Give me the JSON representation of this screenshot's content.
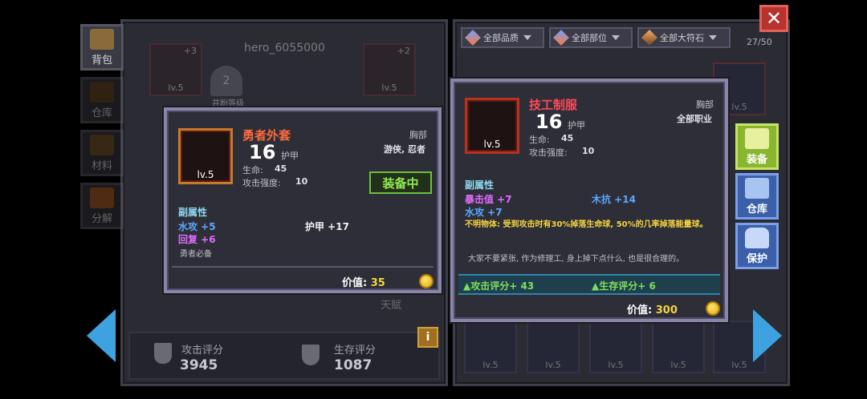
{
  "colors": {
    "accent_blue": "#3fa2e0",
    "close_red": "#b8322e",
    "item_orange": "#ff6a3c",
    "equipped_green": "#8eea4e",
    "gold": "#f4d440"
  },
  "left_tabs": [
    {
      "label": "背包",
      "icon": "backpack-icon"
    },
    {
      "label": "仓库",
      "icon": "warehouse-icon"
    },
    {
      "label": "材料",
      "icon": "materials-icon"
    },
    {
      "label": "分解",
      "icon": "disassemble-icon"
    }
  ],
  "right_tabs": [
    {
      "label": "装备",
      "icon": "armor-icon"
    },
    {
      "label": "仓库",
      "icon": "storage-icon"
    },
    {
      "label": "保护",
      "icon": "lock-icon"
    }
  ],
  "hero": {
    "name": "hero_6055000",
    "rank_title": "井盼等级",
    "rank_level": "2",
    "slot_left": {
      "level": "lv.5",
      "plus": "+3"
    },
    "slot_right": {
      "level": "lv.5",
      "plus": "+2"
    }
  },
  "filters": {
    "quality": "全部品质",
    "slot": "全部部位",
    "rune": "全部大符石",
    "count": "27/50"
  },
  "equipped_item": {
    "name": "勇者外套",
    "level_num": "16",
    "type": "护甲",
    "slot": "胸部",
    "classes": "游侠, 忍者",
    "icon_level": "lv.5",
    "stat1_label": "生命:",
    "stat1_value": "45",
    "stat2_label": "攻击强度:",
    "stat2_value": "10",
    "equipped_badge": "装备中",
    "sub_header": "副属性",
    "sub_attrs": [
      {
        "text": "水攻 +5"
      },
      {
        "text": "护甲 +17"
      },
      {
        "text": "回复 +6"
      }
    ],
    "flavor": "勇者必备",
    "value_label": "价值:",
    "value": "35"
  },
  "compare_item": {
    "name": "技工制服",
    "level_num": "16",
    "type": "护甲",
    "slot": "胸部",
    "classes": "全部职业",
    "icon_level": "lv.5",
    "stat1_label": "生命:",
    "stat1_value": "45",
    "stat2_label": "攻击强度:",
    "stat2_value": "10",
    "sub_header": "副属性",
    "sub_attrs": [
      {
        "text": "暴击值 +7"
      },
      {
        "text": "木抗 +14"
      },
      {
        "text": "水攻 +7"
      }
    ],
    "special": "不明物体: 受到攻击时有30%掉落生命球, 50%的几率掉落能量球。",
    "flavor": "大家不要紧张, 作为修理工, 身上掉下点什么, 也是很合理的。",
    "score_attack": "▲攻击评分+ 43",
    "score_survive": "▲生存评分+ 6",
    "value_label": "价值:",
    "value": "300"
  },
  "bottom_stats": {
    "attack_label": "攻击评分",
    "attack_value": "3945",
    "survive_label": "生存评分",
    "survive_value": "1087",
    "talent_label": "天赋"
  },
  "grid_level": "lv.5",
  "close_symbol": "✕",
  "info_symbol": "i"
}
